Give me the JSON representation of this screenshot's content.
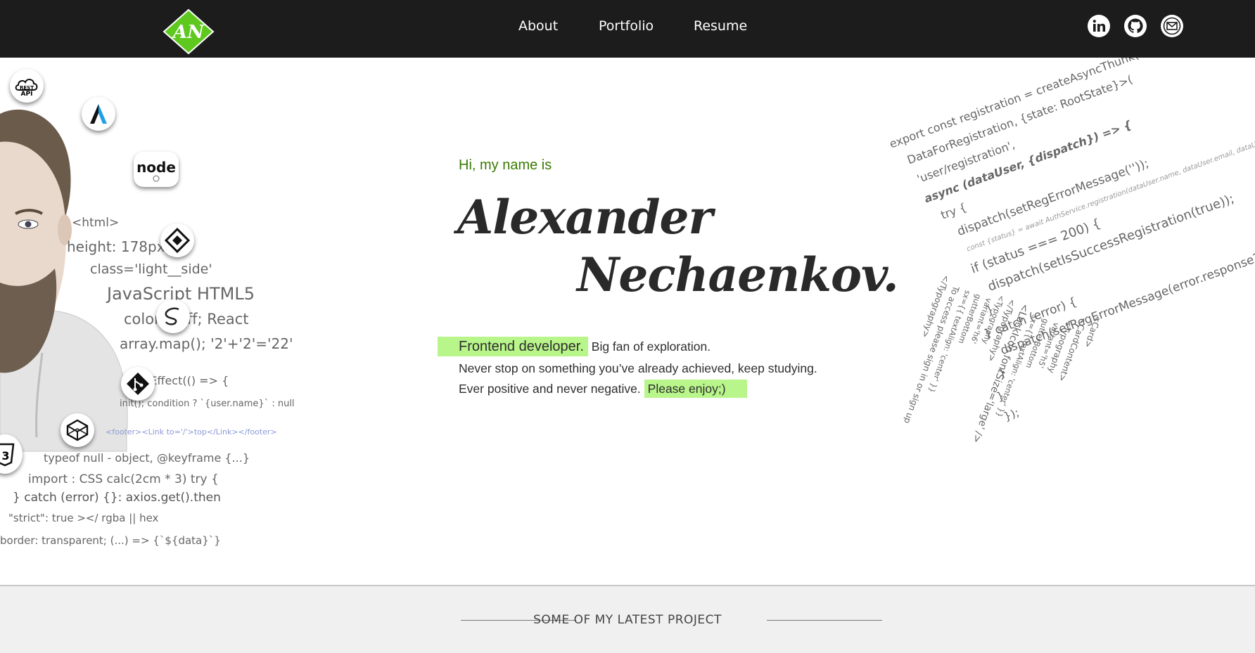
{
  "header": {
    "logo_text": "AN",
    "nav": [
      "About",
      "Portfolio",
      "Resume"
    ],
    "social": [
      "linkedin-icon",
      "github-icon",
      "email-icon"
    ]
  },
  "hero": {
    "greeting": "Hi, my name is",
    "first_name": "Alexander",
    "last_name": "Nechaenkov.",
    "bio": {
      "highlight_role": "Frontend developer.",
      "line1_rest": "Big fan of exploration.",
      "line2": "Never stop on something you’ve already achieved, keep studying.",
      "line3": "Ever positive and never negative.",
      "highlight_end": "Please enjoy;)"
    }
  },
  "left_collage": {
    "tech_icons": [
      "rest-api-icon",
      "aurelia-icon",
      "nodejs-icon",
      "api-hub-icon",
      "sass-icon",
      "git-icon",
      "codepen-icon",
      "css3-icon"
    ],
    "rest_api_label": [
      "REST",
      "API"
    ],
    "node_label": "node",
    "css3_label": "3",
    "code_lines": [
      "<html>",
      "height: 178px;",
      "class='light__side'",
      "JavaScript HTML5",
      "color: #fff; React",
      "array.map(); '2'+'2'='22'",
      "useEffect(() => {",
      "init(); condition ? `{user.name}` : null",
      "<footer><Link to='/'>top</Link></footer>",
      "typeof null - object, @keyframe {...}",
      "import : CSS calc(2cm * 3) try {",
      "} catch (error) {}: axios.get().then",
      "\"strict\": true ></ rgba || hex",
      "border: transparent; (...) => {`${data}`}"
    ]
  },
  "right_code": {
    "lines": [
      "export const registration = createAsyncThunk(",
      "DataForRegistration, {state: RootState}>(",
      "'user/registration',",
      "async (dataUser, {dispatch}) => {",
      "try {",
      "dispatch(setRegErrorMessage(''));",
      "const {status} = await AuthService.registration(dataUser.name, dataUser.email, dataUser.password)",
      "if (status === 200) {",
      "dispatch(setIsSuccessRegistration(true));",
      "}",
      "} catch (error) {",
      "dispatch(setRegErrorMessage(error.response?.data));",
      "}",
      "}",
      "});"
    ],
    "vertical_lines": [
      "<Card>",
      "<CardContent>",
      "<Typography",
      "variant='h5'",
      "gutterBottom",
      "sx={{ textAlign: 'center' }}",
      "<LockIcon fontSize='large' />",
      "</Typography>",
      "<Typography",
      "variant='h6'",
      "gutterBottom",
      "sx={{ textAlign: 'center' }}",
      "To access please sign in or sign up",
      "</Typography>"
    ]
  },
  "section": {
    "title": "SOME OF MY LATEST PROJECT"
  },
  "colors": {
    "header_bg": "#1c1c1c",
    "accent_green": "#66cc22",
    "highlight": "#b8f58a",
    "greeting_text": "#3a7a00",
    "band_bg": "#f0f0f0"
  }
}
